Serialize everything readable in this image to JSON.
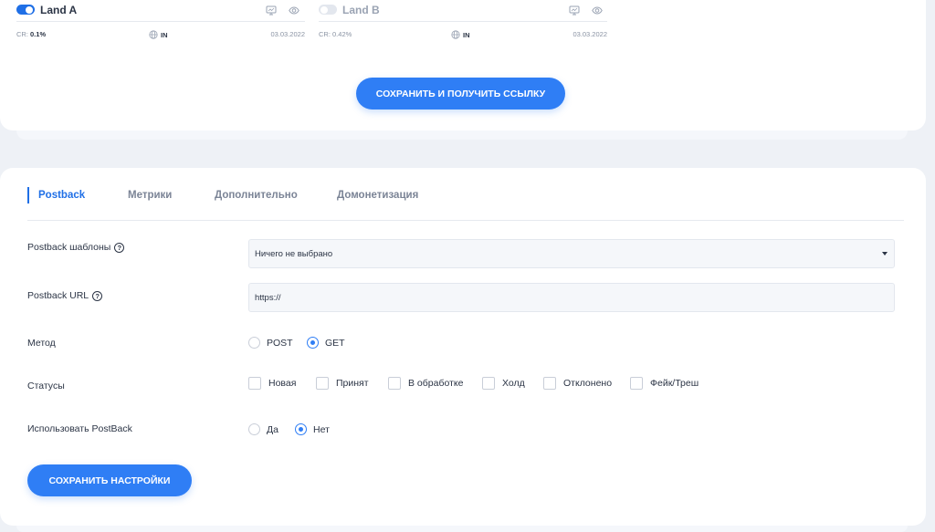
{
  "lands": [
    {
      "name": "Land A",
      "enabled": true,
      "cr_label": "CR:",
      "cr_value": "0.1%",
      "geo": "IN",
      "date": "03.03.2022",
      "icons": [
        "monitor-icon",
        "eye-icon"
      ]
    },
    {
      "name": "Land B",
      "enabled": false,
      "cr_label": "CR:",
      "cr_value": "0.42%",
      "geo": "IN",
      "date": "03.03.2022",
      "icons": [
        "monitor-icon",
        "eye-icon"
      ]
    }
  ],
  "save_link_button": "СОХРАНИТЬ И ПОЛУЧИТЬ ССЫЛКУ",
  "tabs": [
    {
      "label": "Postback",
      "active": true
    },
    {
      "label": "Метрики",
      "active": false
    },
    {
      "label": "Дополнительно",
      "active": false
    },
    {
      "label": "Домонетизация",
      "active": false
    }
  ],
  "form": {
    "templates": {
      "label": "Postback шаблоны",
      "value": "Ничего не выбрано"
    },
    "url": {
      "label": "Postback URL",
      "value": "https://"
    },
    "method": {
      "label": "Метод",
      "options": [
        "POST",
        "GET"
      ],
      "selected": "GET"
    },
    "statuses": {
      "label": "Статусы",
      "options": [
        "Новая",
        "Принят",
        "В обработке",
        "Холд",
        "Отклонено",
        "Фейк/Треш"
      ]
    },
    "use_postback": {
      "label": "Использовать PostBack",
      "options": [
        "Да",
        "Нет"
      ],
      "selected": "Нет"
    },
    "help_glyph": "?"
  },
  "save_settings_button": "СОХРАНИТЬ НАСТРОЙКИ",
  "colors": {
    "accent": "#2f7ef5",
    "tab_active": "#1f6fe6",
    "text": "#2b3445",
    "muted": "#9aa3b3"
  }
}
